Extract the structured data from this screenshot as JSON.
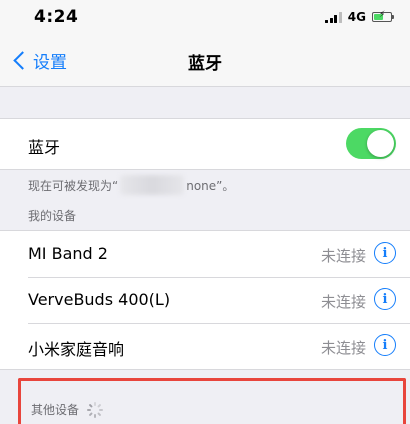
{
  "status_bar": {
    "time": "4:24",
    "network": "4G",
    "battery_level": 0.55,
    "icons": [
      "signal-icon",
      "battery-icon"
    ]
  },
  "nav": {
    "back_label": "设置",
    "title": "蓝牙"
  },
  "bluetooth": {
    "label": "蓝牙",
    "enabled": true
  },
  "discoverable": {
    "prefix": "现在可被发现为“",
    "suffix": "none”。"
  },
  "my_devices": {
    "header": "我的设备",
    "items": [
      {
        "name": "MI Band 2",
        "status": "未连接"
      },
      {
        "name": "VerveBuds 400(L)",
        "status": "未连接"
      },
      {
        "name": "小米家庭音响",
        "status": "未连接"
      }
    ]
  },
  "other_devices": {
    "header": "其他设备"
  },
  "colors": {
    "accent": "#157efb",
    "toggle_on": "#4cd964",
    "highlight_border": "#e8453c"
  }
}
